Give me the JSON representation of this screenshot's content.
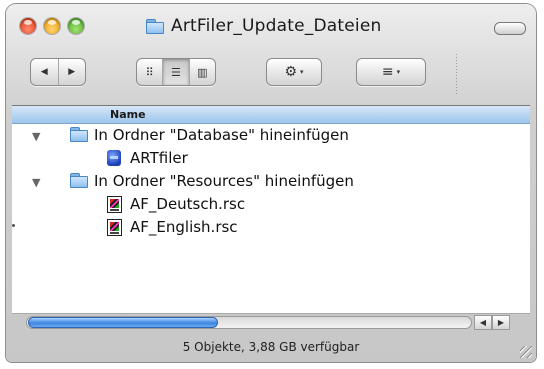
{
  "window": {
    "title": "ArtFiler_Update_Dateien",
    "title_icon": "folder-icon"
  },
  "toolbar": {
    "back_icon": "◀",
    "forward_icon": "▶",
    "view_icon_view": "⠿",
    "view_list": "☰",
    "view_columns": "▥",
    "action_icon": "⚙",
    "arrange_icon": "≡",
    "dropdown_icon": "▾"
  },
  "list": {
    "column_header": "Name",
    "rows": [
      {
        "label": "In Ordner \"Database\" hineinfügen",
        "icon": "folder-icon",
        "expanded": true
      },
      {
        "label": "ARTfiler",
        "icon": "application-icon"
      },
      {
        "label": "In Ordner \"Resources\" hineinfügen",
        "icon": "folder-icon",
        "expanded": true
      },
      {
        "label": "AF_Deutsch.rsc",
        "icon": "resource-file-icon"
      },
      {
        "label": "AF_English.rsc",
        "icon": "resource-file-icon"
      }
    ],
    "disclosure_glyph": "▼"
  },
  "scrollbar": {
    "left_arrow": "◀",
    "right_arrow": "▶",
    "thumb_fraction": 0.42
  },
  "status": {
    "text": "5 Objekte, 3,88 GB verfügbar"
  },
  "colors": {
    "header_blue": "#9cc6ec",
    "scroll_thumb": "#3c86e0",
    "close": "#d6300a",
    "minimize": "#e69200",
    "zoom": "#3f9b1c"
  }
}
